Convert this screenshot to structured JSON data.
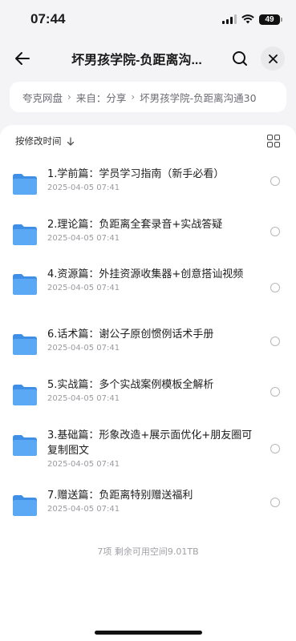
{
  "status_bar": {
    "time": "07:44",
    "battery": "49"
  },
  "nav": {
    "title": "坏男孩学院-负距离沟..."
  },
  "breadcrumb": {
    "root": "夸克网盘",
    "from": "来自：分享",
    "current": "坏男孩学院-负距离沟通30"
  },
  "list": {
    "sort_label": "按修改时间",
    "items": [
      {
        "name": "1.学前篇：学员学习指南（新手必看）",
        "date": "2025-04-05 07:41"
      },
      {
        "name": "2.理论篇：负距离全套录音+实战答疑",
        "date": "2025-04-05 07:41"
      },
      {
        "name": "4.资源篇：外挂资源收集器+创意搭讪视频",
        "date": "2025-04-05 07:41"
      },
      {
        "name": "6.话术篇：谢公子原创惯例话术手册",
        "date": "2025-04-05 07:41"
      },
      {
        "name": "5.实战篇：多个实战案例模板全解析",
        "date": "2025-04-05 07:41"
      },
      {
        "name": "3.基础篇：形象改造+展示面优化+朋友圈可复制图文",
        "date": "2025-04-05 07:41"
      },
      {
        "name": "7.赠送篇：负距离特别赠送福利",
        "date": "2025-04-05 07:41"
      }
    ],
    "summary": "7项 剩余可用空间9.01TB"
  },
  "colors": {
    "folder": "#5ba8f5",
    "folder_dark": "#3f8fe6",
    "accent": "#2f6bff"
  }
}
